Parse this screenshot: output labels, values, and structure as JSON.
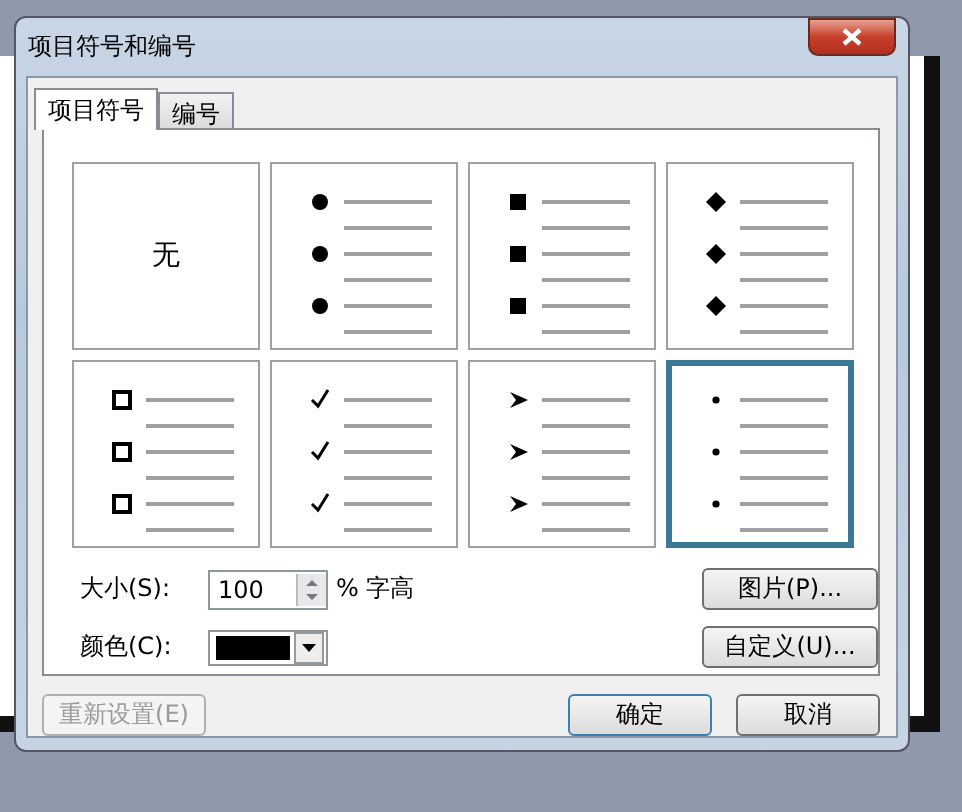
{
  "window": {
    "title": "项目符号和编号"
  },
  "tabs": [
    {
      "label": "项目符号",
      "selected": true
    },
    {
      "label": "编号",
      "selected": false
    }
  ],
  "bullets": [
    {
      "kind": "none",
      "label": "无",
      "selected": false
    },
    {
      "kind": "disc",
      "selected": false
    },
    {
      "kind": "square",
      "selected": false
    },
    {
      "kind": "diamond",
      "selected": false
    },
    {
      "kind": "hollow-square",
      "selected": false
    },
    {
      "kind": "check",
      "selected": false
    },
    {
      "kind": "arrow",
      "selected": false
    },
    {
      "kind": "dot",
      "selected": true
    }
  ],
  "size": {
    "label": "大小(S):",
    "value": "100",
    "unit": "% 字高"
  },
  "color": {
    "label": "颜色(C):",
    "color": "#000000"
  },
  "side_buttons": [
    "图片(P)...",
    "自定义(U)..."
  ],
  "reset_button": {
    "label": "重新设置(E)",
    "disabled": true
  },
  "buttons": [
    "确定",
    "取消"
  ]
}
